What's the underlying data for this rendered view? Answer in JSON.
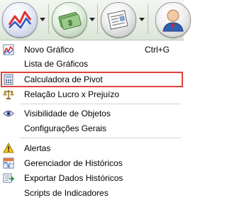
{
  "toolbar": {
    "buttons": [
      {
        "name": "chart",
        "icon": "line-chart-icon",
        "has_dropdown": true
      },
      {
        "name": "money",
        "icon": "money-icon",
        "has_dropdown": true
      },
      {
        "name": "news",
        "icon": "newspaper-icon",
        "has_dropdown": true
      },
      {
        "name": "user",
        "icon": "user-icon",
        "has_dropdown": false
      }
    ]
  },
  "menu": {
    "items": [
      {
        "label": "Novo Gráfico",
        "shortcut": "Ctrl+G",
        "icon": "chart-icon"
      },
      {
        "label": "Lista de Gráficos",
        "shortcut": "",
        "icon": ""
      },
      {
        "label": "Calculadora de Pivot",
        "shortcut": "",
        "icon": "calculator-icon",
        "highlighted": true
      },
      {
        "label": "Relação Lucro x Prejuízo",
        "shortcut": "",
        "icon": "scale-icon"
      },
      {
        "label": "Visibilidade de Objetos",
        "shortcut": "",
        "icon": "eye-icon"
      },
      {
        "label": "Configurações Gerais",
        "shortcut": "",
        "icon": ""
      },
      {
        "label": "Alertas",
        "shortcut": "",
        "icon": "warning-icon"
      },
      {
        "label": "Gerenciador de Históricos",
        "shortcut": "",
        "icon": "history-grid-icon"
      },
      {
        "label": "Exportar Dados Históricos",
        "shortcut": "",
        "icon": "export-icon"
      },
      {
        "label": "Scripts de Indicadores",
        "shortcut": "",
        "icon": ""
      }
    ]
  },
  "colors": {
    "highlight_border": "#e0413c",
    "toolbar_bg": "#e6ece3"
  }
}
